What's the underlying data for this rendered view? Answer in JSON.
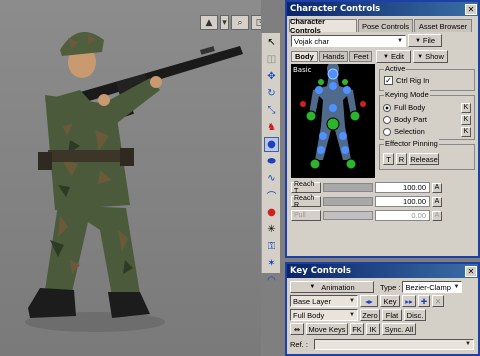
{
  "char_panel": {
    "title": "Character Controls",
    "tabs": [
      "Character Controls",
      "Pose Controls",
      "Asset Browser"
    ],
    "character": "Vojak char",
    "file_label": "File",
    "subtabs": [
      "Body",
      "Hands",
      "Feet"
    ],
    "edit_label": "Edit",
    "show_label": "Show",
    "basic_label": "Basic",
    "active": {
      "label": "Active",
      "ctrl_rig_in": "Ctrl Rig In",
      "checked": true
    },
    "keying_mode": {
      "label": "Keying Mode",
      "options": [
        "Full Body",
        "Body Part",
        "Selection"
      ],
      "selected": "Full Body",
      "k_label": "K"
    },
    "effector_pinning": {
      "label": "Effector Pinning",
      "t": "T",
      "r": "R",
      "release": "Release"
    },
    "sliders": [
      {
        "label": "Reach T",
        "value": "100.00",
        "level": 1.0,
        "a": "A"
      },
      {
        "label": "Reach R",
        "value": "100.00",
        "level": 1.0,
        "a": "A"
      },
      {
        "label": "Pull",
        "value": "0.00",
        "level": 0.0,
        "a": "A"
      }
    ]
  },
  "key_panel": {
    "title": "Key Controls",
    "animation_label": "Animation",
    "type_label": "Type :",
    "type_value": "Bezier-Clamp",
    "layer": "Base Layer",
    "key_label": "Key",
    "body_mode": "Full Body",
    "zero_label": "Zero",
    "flat_label": "Flat",
    "disc_label": "Disc.",
    "move_keys_label": "Move Keys",
    "fk_label": "FK",
    "ik_label": "IK",
    "sync_all_label": "Sync. All",
    "ref_label": "Ref. :"
  },
  "colors": {
    "titlebar": "#0a246a",
    "panel_border": "#1c3fa8",
    "effector_green": "#2bb52b",
    "effector_blue": "#6aa0ff",
    "selection_red": "#d02020"
  },
  "icons": {
    "toolstrip": [
      "select-arrow-icon",
      "lasso-icon",
      "move-icon",
      "rotate-icon",
      "scale-icon",
      "character-icon",
      "sphere-primitive-icon",
      "cylinder-icon",
      "curve-icon",
      "bend-icon",
      "red-dot-icon",
      "joint-icon",
      "skeleton-icon",
      "light-icon",
      "camera-orbit-icon"
    ]
  }
}
